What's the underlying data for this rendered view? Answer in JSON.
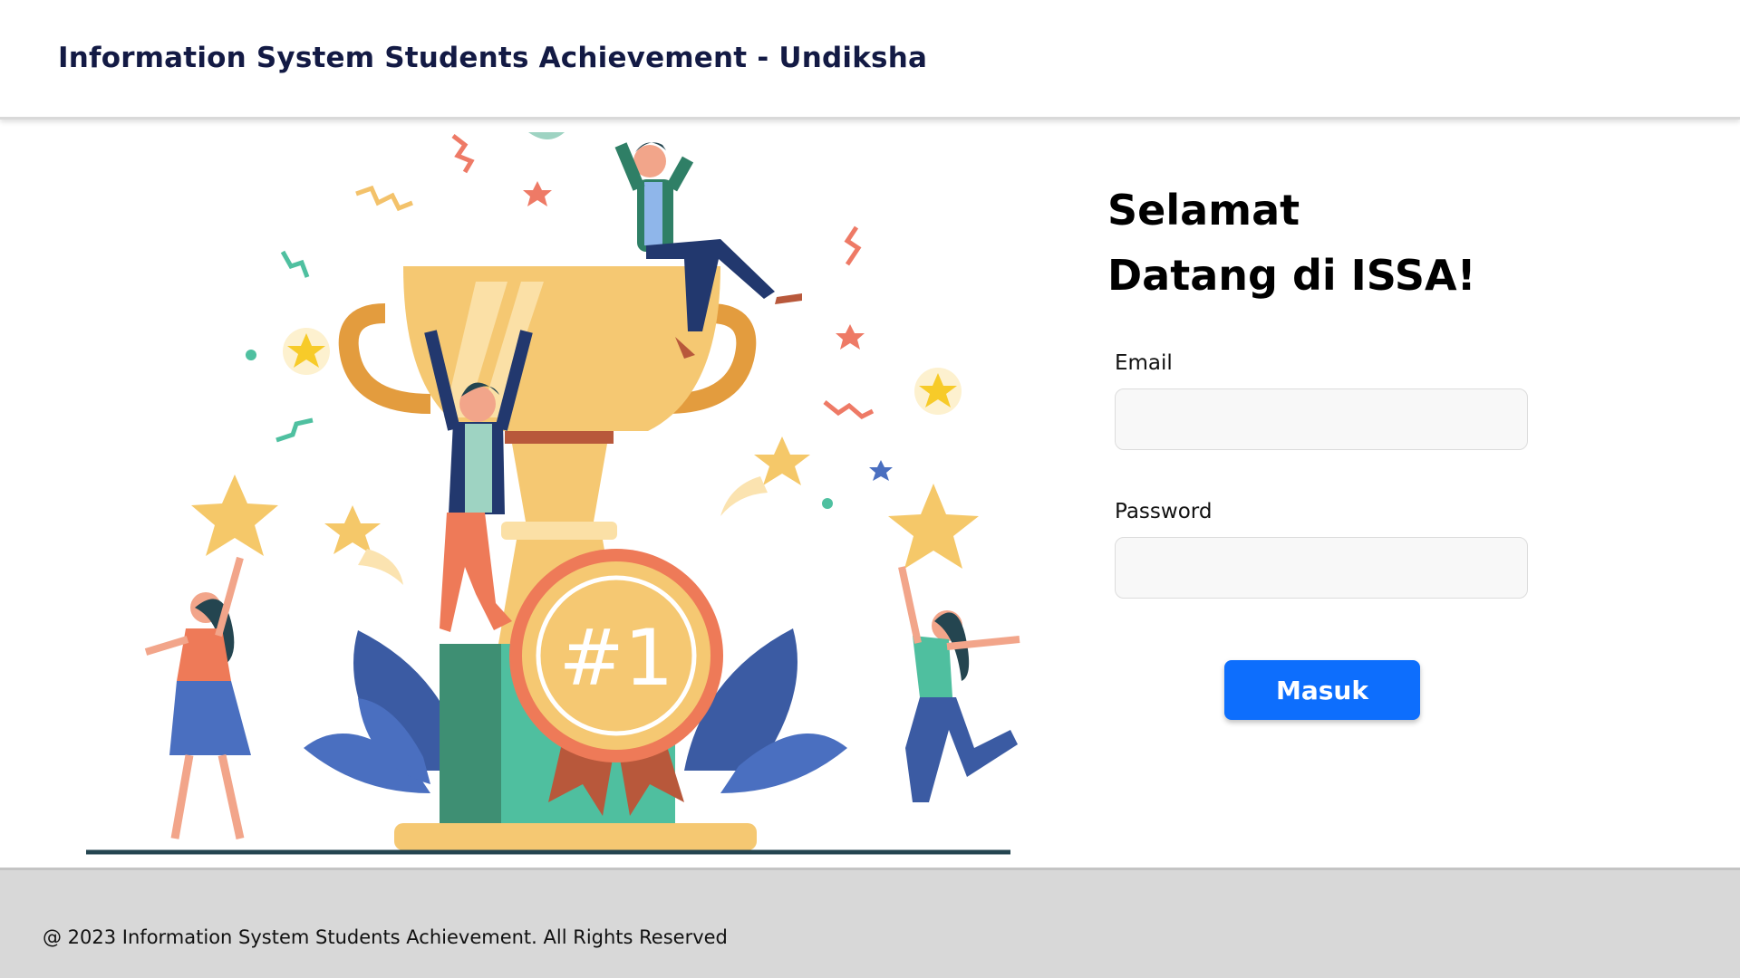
{
  "header": {
    "title": "Information System Students Achievement - Undiksha"
  },
  "hero": {
    "image_name": "trophy-celebration-illustration",
    "badge_text": "#1"
  },
  "login": {
    "welcome_line1": "Selamat",
    "welcome_line2": "Datang di ISSA!",
    "email_label": "Email",
    "email_value": "",
    "email_placeholder": "",
    "password_label": "Password",
    "password_value": "",
    "password_placeholder": "",
    "submit_label": "Masuk"
  },
  "footer": {
    "text": "@ 2023 Information System Students Achievement. All Rights Reserved"
  },
  "colors": {
    "header_text": "#131a44",
    "button_bg": "#0d6efd",
    "footer_bg": "#d8d8d8"
  }
}
